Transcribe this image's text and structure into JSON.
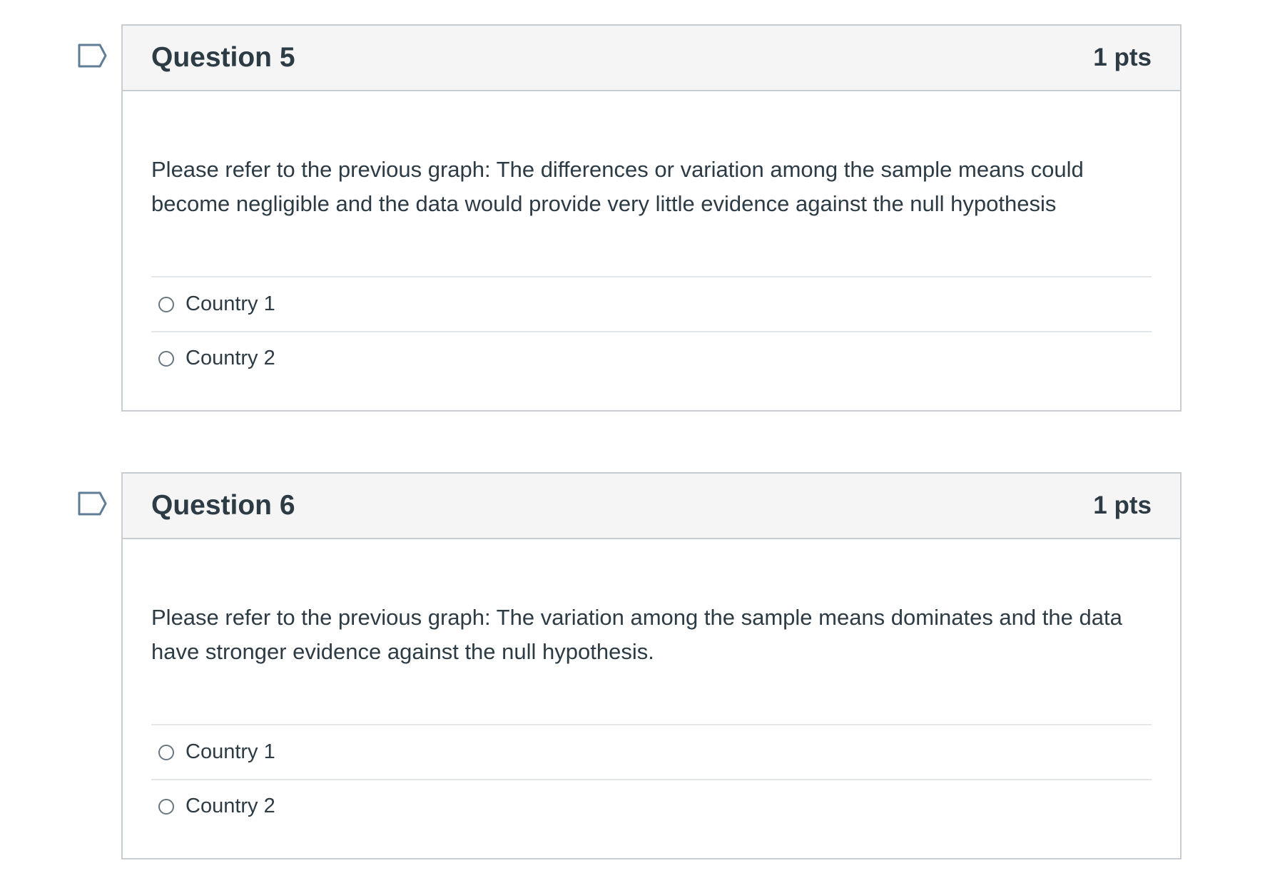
{
  "questions": [
    {
      "title": "Question 5",
      "points": "1 pts",
      "flag_icon": "flag-outline-icon",
      "text": "Please refer to the previous graph: The differences or variation among the sample means could become negligible and the data would provide very little evidence against the null hypothesis",
      "answers": [
        "Country 1",
        "Country 2"
      ]
    },
    {
      "title": "Question 6",
      "points": "1 pts",
      "flag_icon": "flag-outline-icon",
      "text": "Please refer to the previous graph: The variation among the sample means dominates and the data have stronger evidence against the null hypothesis.",
      "answers": [
        "Country 1",
        "Country 2"
      ]
    }
  ],
  "colors": {
    "header_bg": "#f5f5f5",
    "border": "#c7cdd1",
    "text": "#2d3b45",
    "flag_stroke": "#5f7d95"
  }
}
